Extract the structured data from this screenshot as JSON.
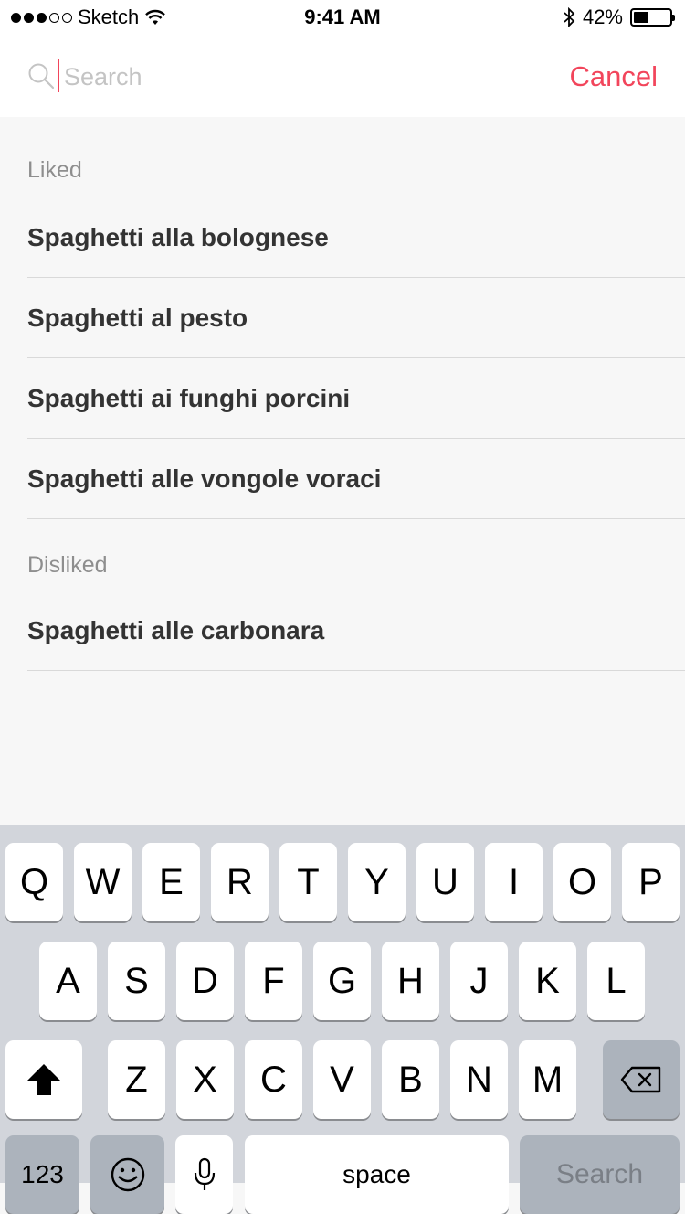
{
  "status": {
    "carrier": "Sketch",
    "time": "9:41 AM",
    "battery": "42%",
    "battery_level": 0.42,
    "signal_bars": 3,
    "signal_total": 5
  },
  "search": {
    "placeholder": "Search",
    "value": "",
    "cancel_label": "Cancel",
    "accent_color": "#f2455b"
  },
  "sections": [
    {
      "title": "Liked",
      "items": [
        "Spaghetti alla bolognese",
        "Spaghetti al pesto",
        "Spaghetti ai funghi porcini",
        "Spaghetti alle vongole voraci"
      ]
    },
    {
      "title": "Disliked",
      "items": [
        "Spaghetti alle carbonara"
      ]
    }
  ],
  "keyboard": {
    "row1": [
      "Q",
      "W",
      "E",
      "R",
      "T",
      "Y",
      "U",
      "I",
      "O",
      "P"
    ],
    "row2": [
      "A",
      "S",
      "D",
      "F",
      "G",
      "H",
      "J",
      "K",
      "L"
    ],
    "row3": [
      "Z",
      "X",
      "C",
      "V",
      "B",
      "N",
      "M"
    ],
    "numbers_label": "123",
    "space_label": "space",
    "return_label": "Search",
    "icons": {
      "shift": "shift-icon",
      "delete": "backspace-icon",
      "emoji": "emoji-icon",
      "mic": "microphone-icon"
    }
  }
}
